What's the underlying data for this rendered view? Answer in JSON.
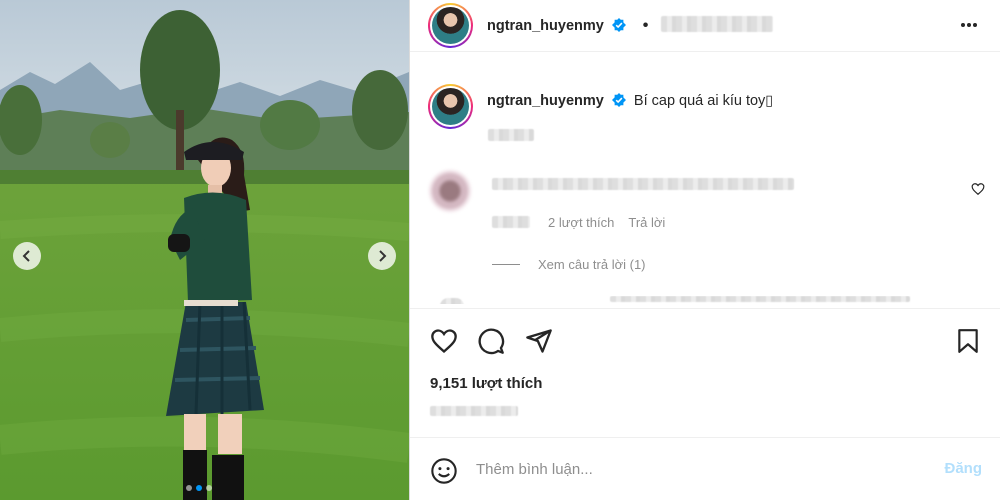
{
  "post": {
    "username": "ngtran_huyenmy",
    "caption_text": "Bí cap quá ai kíu toy",
    "caption_emoji": "▯",
    "likes_label": "9,151 lượt thích"
  },
  "comment": {
    "likes_label": "2 lượt thích",
    "reply_label": "Trả lời",
    "view_replies_label": "Xem câu trả lời (1)"
  },
  "composer": {
    "placeholder": "Thêm bình luận...",
    "post_label": "Đăng"
  },
  "icons": {
    "verified": "verified-badge-icon",
    "more": "more-options-icon",
    "heart": "heart-icon",
    "comment": "comment-icon",
    "share": "paper-plane-icon",
    "save": "bookmark-icon",
    "emoji": "emoji-icon",
    "prev": "chevron-left-icon",
    "next": "chevron-right-icon"
  },
  "colors": {
    "verified_blue": "#0095f6",
    "post_button_disabled": "#b2dffc",
    "muted_text": "#8e8e8e"
  },
  "carousel": {
    "slide_count": 3,
    "active_index": 1
  }
}
